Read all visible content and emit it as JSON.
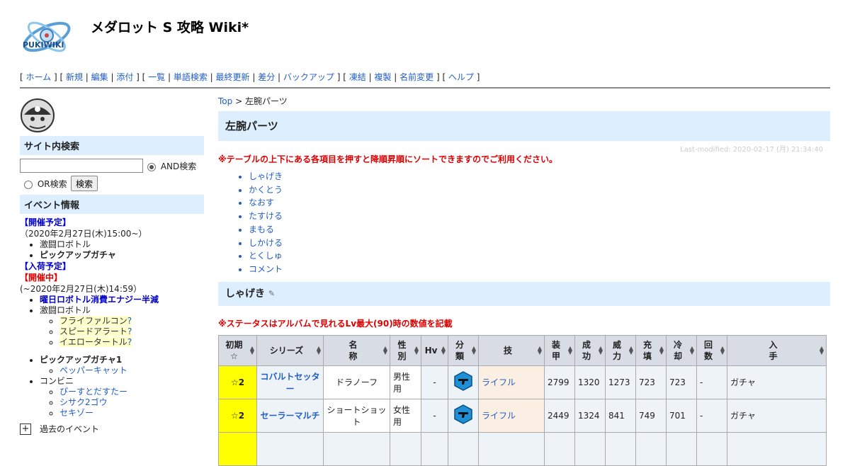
{
  "header": {
    "site_title": "メダロット S 攻略 Wiki*",
    "logo_text": "PUKIWIKI"
  },
  "navbar": {
    "groups": [
      [
        "ホーム"
      ],
      [
        "新規",
        "編集",
        "添付"
      ],
      [
        "一覧",
        "単語検索",
        "最終更新",
        "差分",
        "バックアップ"
      ],
      [
        "凍結",
        "複製",
        "名前変更"
      ],
      [
        "ヘルプ"
      ]
    ]
  },
  "sidebar": {
    "search": {
      "heading": "サイト内検索",
      "and_label": "AND検索",
      "or_label": "OR検索",
      "button": "検索",
      "value": ""
    },
    "events": {
      "heading": "イベント情報",
      "scheduled_label": "【開催予定】",
      "scheduled_date": "（2020年2月27日(木)15:00~）",
      "scheduled_items": [
        "激闘ロボトル",
        "ピックアップガチャ"
      ],
      "arrival_label": "【入荷予定】",
      "current_label": "【開催中】",
      "current_date": "(~2020年2月27日(木)14:59）",
      "current_items": {
        "weekday": "曜日ロボトル消費エナジー半減",
        "battle": "激闘ロボトル",
        "battle_subs": [
          "フライファルコン",
          "スピードアラート",
          "イエロータートル"
        ],
        "pickup": "ピックアップガチャ1",
        "pickup_subs": [
          "ペッパーキャット"
        ],
        "convenience": "コンビニ",
        "convenience_subs": [
          "ぴーすとだすたー",
          "シサク2ゴウ",
          "セキゾー"
        ]
      },
      "past_toggle": "+",
      "past_label": "過去のイベント",
      "question_mark": "?"
    }
  },
  "main": {
    "breadcrumb": {
      "top": "Top",
      "sep": " > ",
      "current": "左腕パーツ"
    },
    "title": "左腕パーツ",
    "last_modified": "Last-modified: 2020-02-17 (月) 21:34:40",
    "sort_note": "※テーブルの上下にある各項目を押すと降順昇順にソートできますのでご利用ください。",
    "toc": [
      "しゃげき",
      "かくとう",
      "なおす",
      "たすける",
      "まもる",
      "しかける",
      "とくしゅ",
      "コメント"
    ],
    "section": {
      "heading": "しゃげき",
      "status_note": "※ステータスはアルバムで見れるLv最大(90)時の数値を記載"
    },
    "table": {
      "headers": [
        "初期☆",
        "シリーズ",
        "名称",
        "性別",
        "Hv",
        "分類",
        "技",
        "装甲",
        "成功",
        "威力",
        "充填",
        "冷却",
        "回数",
        "入手"
      ],
      "rows": [
        {
          "star": "☆2",
          "series": "コバルトセッター",
          "name": "ドラノーフ",
          "gender": "男性用",
          "hv": "-",
          "type_icon": "pistol-icon",
          "skill": "ライフル",
          "armor": "2799",
          "success": "1320",
          "power": "1273",
          "charge": "723",
          "cool": "723",
          "count": "-",
          "obtain": "ガチャ"
        },
        {
          "star": "☆2",
          "series": "セーラーマルチ",
          "name": "ショートショット",
          "gender": "女性用",
          "hv": "-",
          "type_icon": "pistol-icon",
          "skill": "ライフル",
          "armor": "2449",
          "success": "1324",
          "power": "841",
          "charge": "749",
          "cool": "701",
          "count": "-",
          "obtain": "ガチャ"
        }
      ]
    }
  },
  "colors": {
    "link": "#215dc6",
    "heading_bg": "#ddeeff",
    "note_red": "#dd0000",
    "star_bg": "#ffff00"
  }
}
